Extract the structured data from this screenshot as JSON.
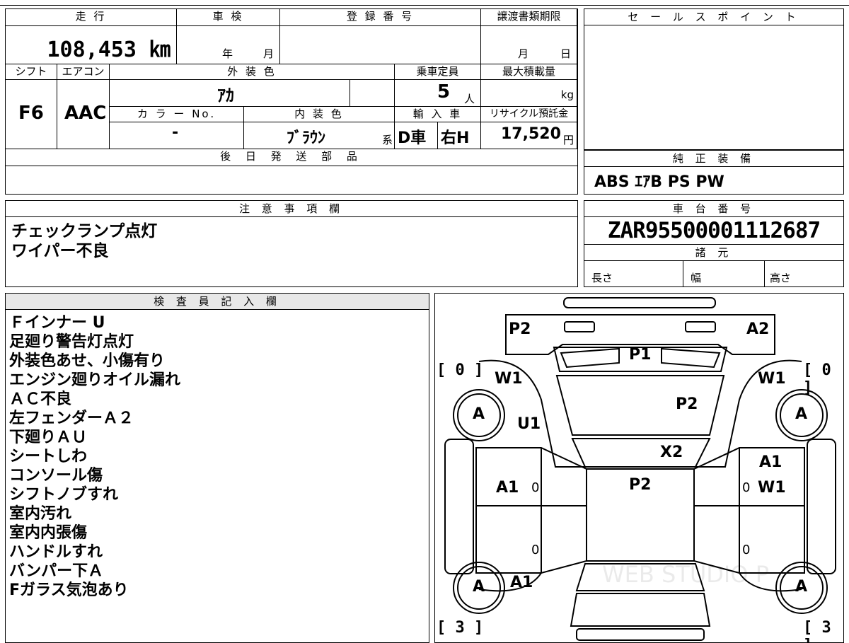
{
  "top_table": {
    "mileage_label": "走 行",
    "mileage_value": "108,453 ㎞",
    "inspection_label": "車 検",
    "inspection_year": "年",
    "inspection_month": "月",
    "registration_label": "登 録 番 号",
    "transfer_label": "譲渡書類期限",
    "transfer_month": "月",
    "transfer_day": "日",
    "shift_label": "シフト",
    "shift_value": "F6",
    "ac_label": "エアコン",
    "ac_value": "AAC",
    "exterior_label": "外 装 色",
    "exterior_value": "ｱｶ",
    "capacity_label": "乗車定員",
    "capacity_value": "5",
    "capacity_unit": "人",
    "maxload_label": "最大積載量",
    "maxload_unit": "kg",
    "colorno_label": "カ ラ ー No.",
    "colorno_value": "-",
    "interior_label": "内 装 色",
    "interior_value": "ﾌﾞﾗｳﾝ",
    "interior_suffix": "系",
    "import_label": "輸 入 車",
    "import_value1": "D車",
    "import_value2": "右H",
    "recycle_label": "リサイクル預託金",
    "recycle_value": "17,520",
    "recycle_unit": "円",
    "later_parts_label": "後 日 発 送 部 品"
  },
  "sales_point": {
    "label": "セ ー ル ス ポ イ ン ト"
  },
  "genuine_equipment": {
    "label": "純 正 装 備",
    "value": "ABS ｴｱB PS PW"
  },
  "notes": {
    "label": "注 意 事 項 欄",
    "lines": [
      "チェックランプ点灯",
      "ワイパー不良"
    ]
  },
  "chassis": {
    "label": "車 台 番 号",
    "value": "ZAR95500001112687"
  },
  "specs": {
    "label": "諸 元",
    "length": "長さ",
    "width": "幅",
    "height": "高さ"
  },
  "inspector": {
    "label": "検 査 員 記 入 欄",
    "lines": [
      "Ｆインナー U",
      "足廻り警告灯点灯",
      "外装色あせ、小傷有り",
      "エンジン廻りオイル漏れ",
      "ＡＣ不良",
      "左フェンダーＡ２",
      "下廻りＡＵ",
      "シートしわ",
      "コンソール傷",
      "シフトノブすれ",
      "室内汚れ",
      "室内内張傷",
      "ハンドルすれ",
      "バンパー下Ａ",
      "Fガラス気泡あり"
    ]
  },
  "diagram": {
    "labels": {
      "p2_front_left": "P2",
      "a2_front_right": "A2",
      "p1_hood": "P1",
      "w1_left": "W1",
      "w1_right": "W1",
      "p2_windshield": "P2",
      "u1": "U1",
      "x2": "X2",
      "a1_right_door": "A1",
      "a1_left_door": "A1",
      "w1_right_door": "W1",
      "p2_roof": "P2",
      "a1_rear_left": "A1"
    },
    "tires": {
      "front_left": "A",
      "front_right": "A",
      "rear_left": "A",
      "rear_right": "A"
    },
    "tread": {
      "front_left": "[ 0 ]",
      "front_right": "[ 0 ]",
      "rear_left": "[ 3 ]",
      "rear_right": "[ 3 ]"
    },
    "door_marks": [
      "0",
      "0",
      "0",
      "0"
    ],
    "watermark": "WEB STUDIO P"
  }
}
